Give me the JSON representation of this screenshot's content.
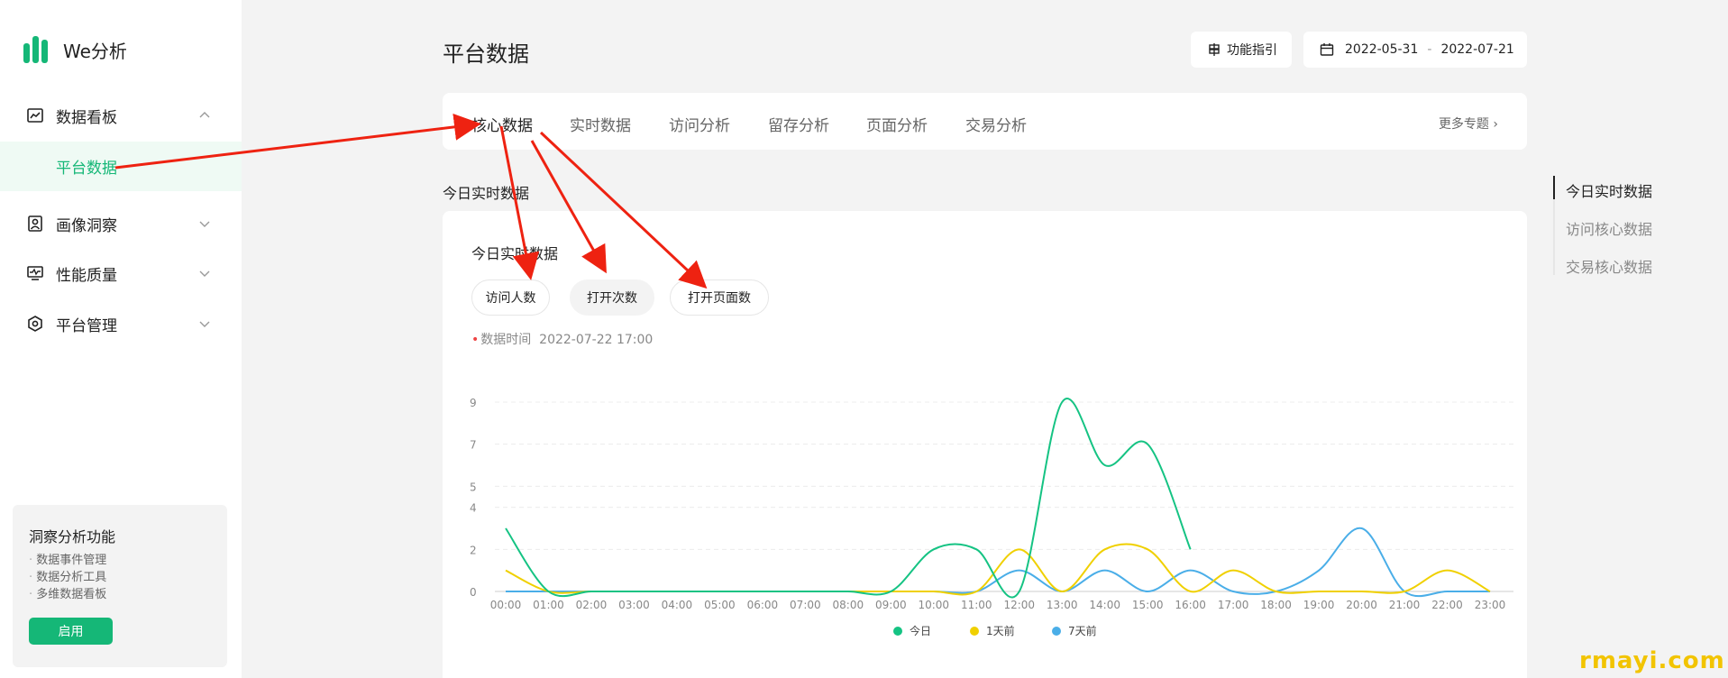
{
  "app": {
    "name": "We分析"
  },
  "sidebar": {
    "groups": [
      {
        "label": "数据看板",
        "icon": "chart-board-icon"
      },
      {
        "label": "画像洞察",
        "icon": "portrait-icon"
      },
      {
        "label": "性能质量",
        "icon": "monitor-icon"
      },
      {
        "label": "平台管理",
        "icon": "hexagon-settings-icon"
      }
    ],
    "active_sub_item": "平台数据",
    "promo": {
      "title": "洞察分析功能",
      "items": [
        "数据事件管理",
        "数据分析工具",
        "多维数据看板"
      ],
      "button": "启用"
    }
  },
  "header": {
    "title": "平台数据",
    "guide_label": "功能指引",
    "date_start": "2022-05-31",
    "date_sep": "-",
    "date_end": "2022-07-21"
  },
  "tabs": [
    {
      "label": "核心数据",
      "active": true
    },
    {
      "label": "实时数据"
    },
    {
      "label": "访问分析"
    },
    {
      "label": "留存分析"
    },
    {
      "label": "页面分析"
    },
    {
      "label": "交易分析"
    }
  ],
  "more_topics": "更多专题",
  "section_heading": "今日实时数据",
  "card": {
    "title": "今日实时数据",
    "metrics": [
      "访问人数",
      "打开次数",
      "打开页面数"
    ],
    "active_metric": 1,
    "data_time_label": "数据时间",
    "data_time_value": "2022-07-22 17:00"
  },
  "toc": {
    "items": [
      "今日实时数据",
      "访问核心数据",
      "交易核心数据"
    ],
    "active": 0
  },
  "watermark": "rmayi.com",
  "colors": {
    "accent": "#15b777",
    "today": "#15c383",
    "one_day_ago": "#f0d000",
    "seven_days_ago": "#4aaee8",
    "arrow": "#ee2211"
  },
  "chart_data": {
    "type": "line",
    "smooth": true,
    "categories": [
      "00:00",
      "01:00",
      "02:00",
      "03:00",
      "04:00",
      "05:00",
      "06:00",
      "07:00",
      "08:00",
      "09:00",
      "10:00",
      "11:00",
      "12:00",
      "13:00",
      "14:00",
      "15:00",
      "16:00",
      "17:00",
      "18:00",
      "19:00",
      "20:00",
      "21:00",
      "22:00",
      "23:00"
    ],
    "yticks": [
      0,
      2,
      4,
      5,
      7,
      9
    ],
    "ylim": [
      0,
      9
    ],
    "grid": true,
    "legend_position": "bottom",
    "series": [
      {
        "name": "今日",
        "values": [
          3,
          0,
          0,
          0,
          0,
          0,
          0,
          0,
          0,
          0,
          2,
          2,
          0,
          9,
          6,
          7,
          2
        ]
      },
      {
        "name": "1天前",
        "values": [
          1,
          0,
          0,
          0,
          0,
          0,
          0,
          0,
          0,
          0,
          0,
          0,
          2,
          0,
          2,
          2,
          0,
          1,
          0,
          0,
          0,
          0,
          1,
          0
        ]
      },
      {
        "name": "7天前",
        "values": [
          0,
          0,
          0,
          0,
          0,
          0,
          0,
          0,
          0,
          0,
          0,
          0,
          1,
          0,
          1,
          0,
          1,
          0,
          0,
          1,
          3,
          0,
          0,
          0
        ]
      }
    ]
  }
}
